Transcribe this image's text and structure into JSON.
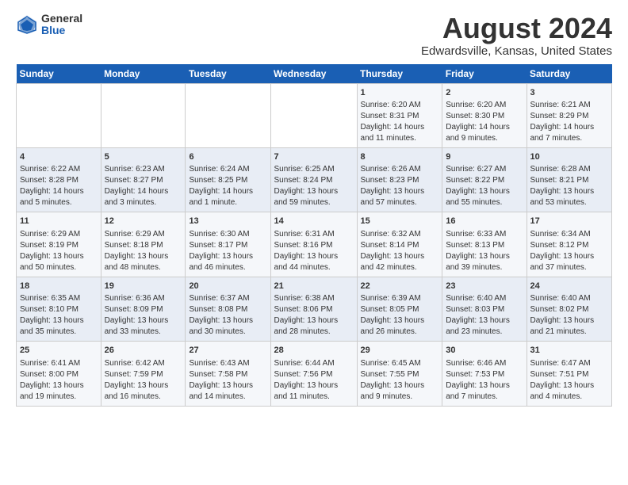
{
  "logo": {
    "general": "General",
    "blue": "Blue"
  },
  "title": "August 2024",
  "subtitle": "Edwardsville, Kansas, United States",
  "days_header": [
    "Sunday",
    "Monday",
    "Tuesday",
    "Wednesday",
    "Thursday",
    "Friday",
    "Saturday"
  ],
  "weeks": [
    [
      {
        "day": "",
        "content": ""
      },
      {
        "day": "",
        "content": ""
      },
      {
        "day": "",
        "content": ""
      },
      {
        "day": "",
        "content": ""
      },
      {
        "day": "1",
        "content": "Sunrise: 6:20 AM\nSunset: 8:31 PM\nDaylight: 14 hours and 11 minutes."
      },
      {
        "day": "2",
        "content": "Sunrise: 6:20 AM\nSunset: 8:30 PM\nDaylight: 14 hours and 9 minutes."
      },
      {
        "day": "3",
        "content": "Sunrise: 6:21 AM\nSunset: 8:29 PM\nDaylight: 14 hours and 7 minutes."
      }
    ],
    [
      {
        "day": "4",
        "content": "Sunrise: 6:22 AM\nSunset: 8:28 PM\nDaylight: 14 hours and 5 minutes."
      },
      {
        "day": "5",
        "content": "Sunrise: 6:23 AM\nSunset: 8:27 PM\nDaylight: 14 hours and 3 minutes."
      },
      {
        "day": "6",
        "content": "Sunrise: 6:24 AM\nSunset: 8:25 PM\nDaylight: 14 hours and 1 minute."
      },
      {
        "day": "7",
        "content": "Sunrise: 6:25 AM\nSunset: 8:24 PM\nDaylight: 13 hours and 59 minutes."
      },
      {
        "day": "8",
        "content": "Sunrise: 6:26 AM\nSunset: 8:23 PM\nDaylight: 13 hours and 57 minutes."
      },
      {
        "day": "9",
        "content": "Sunrise: 6:27 AM\nSunset: 8:22 PM\nDaylight: 13 hours and 55 minutes."
      },
      {
        "day": "10",
        "content": "Sunrise: 6:28 AM\nSunset: 8:21 PM\nDaylight: 13 hours and 53 minutes."
      }
    ],
    [
      {
        "day": "11",
        "content": "Sunrise: 6:29 AM\nSunset: 8:19 PM\nDaylight: 13 hours and 50 minutes."
      },
      {
        "day": "12",
        "content": "Sunrise: 6:29 AM\nSunset: 8:18 PM\nDaylight: 13 hours and 48 minutes."
      },
      {
        "day": "13",
        "content": "Sunrise: 6:30 AM\nSunset: 8:17 PM\nDaylight: 13 hours and 46 minutes."
      },
      {
        "day": "14",
        "content": "Sunrise: 6:31 AM\nSunset: 8:16 PM\nDaylight: 13 hours and 44 minutes."
      },
      {
        "day": "15",
        "content": "Sunrise: 6:32 AM\nSunset: 8:14 PM\nDaylight: 13 hours and 42 minutes."
      },
      {
        "day": "16",
        "content": "Sunrise: 6:33 AM\nSunset: 8:13 PM\nDaylight: 13 hours and 39 minutes."
      },
      {
        "day": "17",
        "content": "Sunrise: 6:34 AM\nSunset: 8:12 PM\nDaylight: 13 hours and 37 minutes."
      }
    ],
    [
      {
        "day": "18",
        "content": "Sunrise: 6:35 AM\nSunset: 8:10 PM\nDaylight: 13 hours and 35 minutes."
      },
      {
        "day": "19",
        "content": "Sunrise: 6:36 AM\nSunset: 8:09 PM\nDaylight: 13 hours and 33 minutes."
      },
      {
        "day": "20",
        "content": "Sunrise: 6:37 AM\nSunset: 8:08 PM\nDaylight: 13 hours and 30 minutes."
      },
      {
        "day": "21",
        "content": "Sunrise: 6:38 AM\nSunset: 8:06 PM\nDaylight: 13 hours and 28 minutes."
      },
      {
        "day": "22",
        "content": "Sunrise: 6:39 AM\nSunset: 8:05 PM\nDaylight: 13 hours and 26 minutes."
      },
      {
        "day": "23",
        "content": "Sunrise: 6:40 AM\nSunset: 8:03 PM\nDaylight: 13 hours and 23 minutes."
      },
      {
        "day": "24",
        "content": "Sunrise: 6:40 AM\nSunset: 8:02 PM\nDaylight: 13 hours and 21 minutes."
      }
    ],
    [
      {
        "day": "25",
        "content": "Sunrise: 6:41 AM\nSunset: 8:00 PM\nDaylight: 13 hours and 19 minutes."
      },
      {
        "day": "26",
        "content": "Sunrise: 6:42 AM\nSunset: 7:59 PM\nDaylight: 13 hours and 16 minutes."
      },
      {
        "day": "27",
        "content": "Sunrise: 6:43 AM\nSunset: 7:58 PM\nDaylight: 13 hours and 14 minutes."
      },
      {
        "day": "28",
        "content": "Sunrise: 6:44 AM\nSunset: 7:56 PM\nDaylight: 13 hours and 11 minutes."
      },
      {
        "day": "29",
        "content": "Sunrise: 6:45 AM\nSunset: 7:55 PM\nDaylight: 13 hours and 9 minutes."
      },
      {
        "day": "30",
        "content": "Sunrise: 6:46 AM\nSunset: 7:53 PM\nDaylight: 13 hours and 7 minutes."
      },
      {
        "day": "31",
        "content": "Sunrise: 6:47 AM\nSunset: 7:51 PM\nDaylight: 13 hours and 4 minutes."
      }
    ]
  ]
}
